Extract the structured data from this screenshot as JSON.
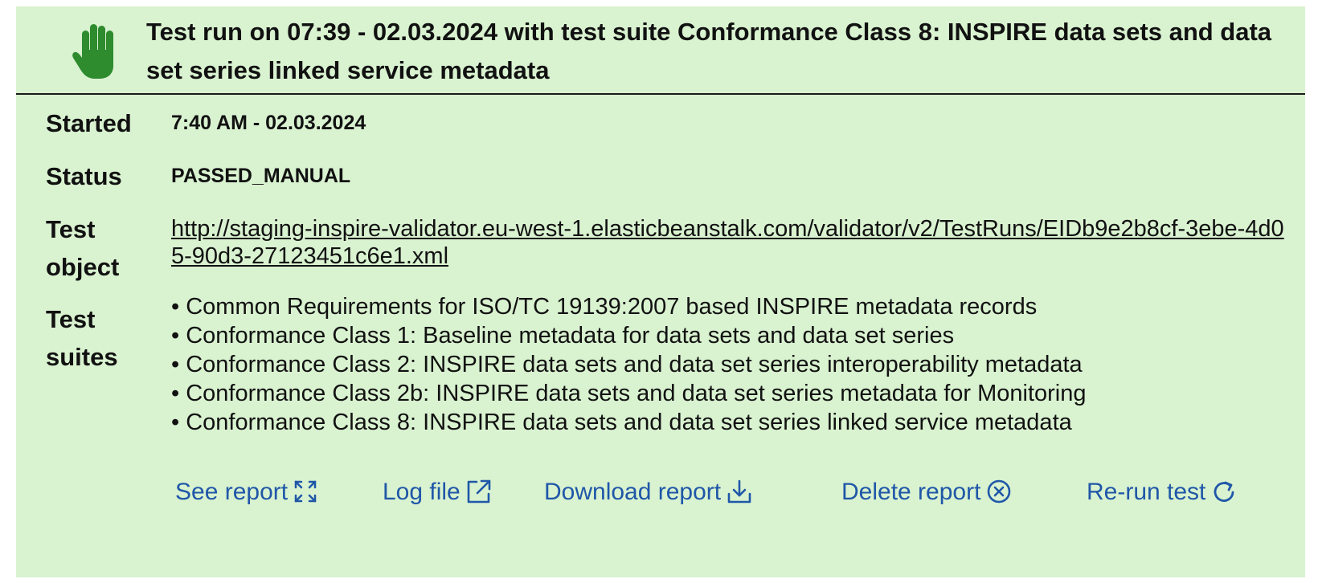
{
  "header": {
    "title": "Test run on 07:39 - 02.03.2024 with test suite Conformance Class 8: INSPIRE data sets and data set series linked service metadata",
    "status_icon": "hand-icon",
    "status_color": "#2e8b2e"
  },
  "details": {
    "started_label": "Started",
    "started_value": "7:40 AM - 02.03.2024",
    "status_label": "Status",
    "status_value": "PASSED_MANUAL",
    "test_object_label": "Test object",
    "test_object_url": "http://staging-inspire-validator.eu-west-1.elasticbeanstalk.com/validator/v2/TestRuns/EIDb9e2b8cf-3ebe-4d05-90d3-27123451c6e1.xml",
    "test_suites_label": "Test suites",
    "test_suites": [
      "• Common Requirements for ISO/TC 19139:2007 based INSPIRE metadata records",
      "• Conformance Class 1: Baseline metadata for data sets and data set series",
      "• Conformance Class 2: INSPIRE data sets and data set series interoperability metadata",
      "• Conformance Class 2b: INSPIRE data sets and data set series metadata for Monitoring",
      "• Conformance Class 8: INSPIRE data sets and data set series linked service metadata"
    ]
  },
  "actions": {
    "see_report": "See report",
    "log_file": "Log file",
    "download_report": "Download report",
    "delete_report": "Delete report",
    "rerun_test": "Re-run test",
    "link_color": "#1f57a8"
  },
  "colors": {
    "panel_background": "#d9f2d0",
    "text": "#111111"
  }
}
